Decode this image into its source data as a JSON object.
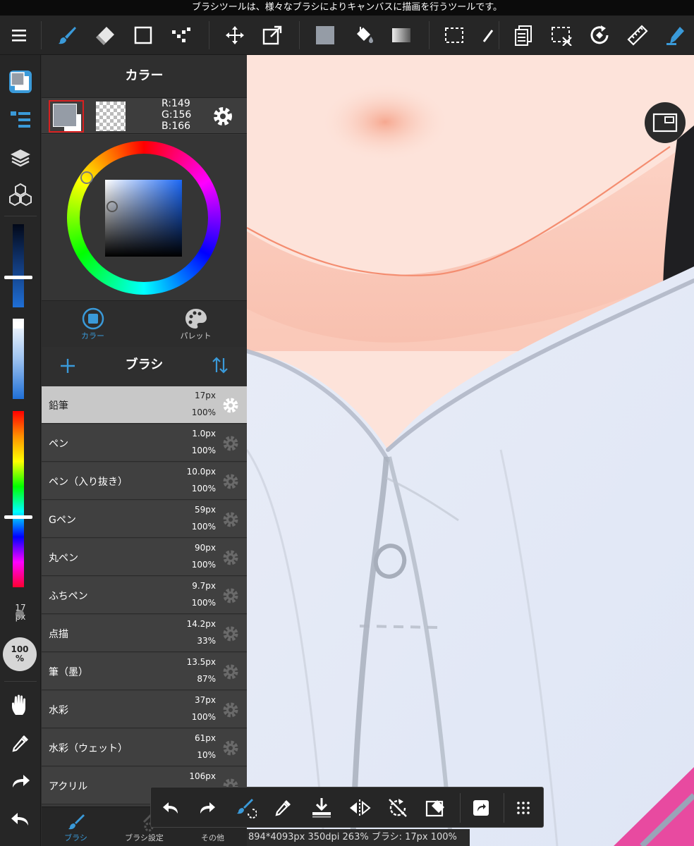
{
  "tooltip": "ブラシツールは、様々なブラシによりキャンバスに描画を行うツールです。",
  "colors": {
    "accent": "#3a9ad9",
    "selected_swatch_border": "#d82020",
    "foreground": "#959ca6"
  },
  "toolbar": {
    "icons": [
      "menu-icon",
      "brush-icon",
      "eraser-icon",
      "rectangle-icon",
      "dot-tool-icon",
      "move-icon",
      "transform-icon",
      "fill-swatch-icon",
      "bucket-icon",
      "gradient-icon",
      "selection-icon",
      "magic-wand-icon",
      "copy-icon",
      "deselect-icon",
      "rotate-icon",
      "ruler-icon",
      "pen-icon"
    ]
  },
  "rail": {
    "brush_size_label": "17",
    "brush_size_unit": "px",
    "opacity_value": "100",
    "opacity_unit": "%"
  },
  "color_panel": {
    "title": "カラー",
    "rgb": {
      "r": "R:149",
      "g": "G:156",
      "b": "B:166"
    },
    "tabs": [
      {
        "label": "カラー",
        "active": true
      },
      {
        "label": "パレット",
        "active": false
      }
    ]
  },
  "brush_panel": {
    "title": "ブラシ",
    "brushes": [
      {
        "name": "鉛筆",
        "size": "17px",
        "opacity": "100%",
        "selected": true
      },
      {
        "name": "ペン",
        "size": "1.0px",
        "opacity": "100%",
        "selected": false
      },
      {
        "name": "ペン（入り抜き）",
        "size": "10.0px",
        "opacity": "100%",
        "selected": false
      },
      {
        "name": "Gペン",
        "size": "59px",
        "opacity": "100%",
        "selected": false
      },
      {
        "name": "丸ペン",
        "size": "90px",
        "opacity": "100%",
        "selected": false
      },
      {
        "name": "ふちペン",
        "size": "9.7px",
        "opacity": "100%",
        "selected": false
      },
      {
        "name": "点描",
        "size": "14.2px",
        "opacity": "33%",
        "selected": false
      },
      {
        "name": "筆（墨）",
        "size": "13.5px",
        "opacity": "87%",
        "selected": false
      },
      {
        "name": "水彩",
        "size": "37px",
        "opacity": "100%",
        "selected": false
      },
      {
        "name": "水彩（ウェット）",
        "size": "61px",
        "opacity": "10%",
        "selected": false
      },
      {
        "name": "アクリル",
        "size": "106px",
        "opacity": "",
        "selected": false
      }
    ]
  },
  "bottom_tabs": [
    {
      "label": "ブラシ",
      "active": true
    },
    {
      "label": "ブラシ設定",
      "active": false
    },
    {
      "label": "その他",
      "active": false
    }
  ],
  "status": "894*4093px 350dpi 263% ブラシ: 17px 100%"
}
